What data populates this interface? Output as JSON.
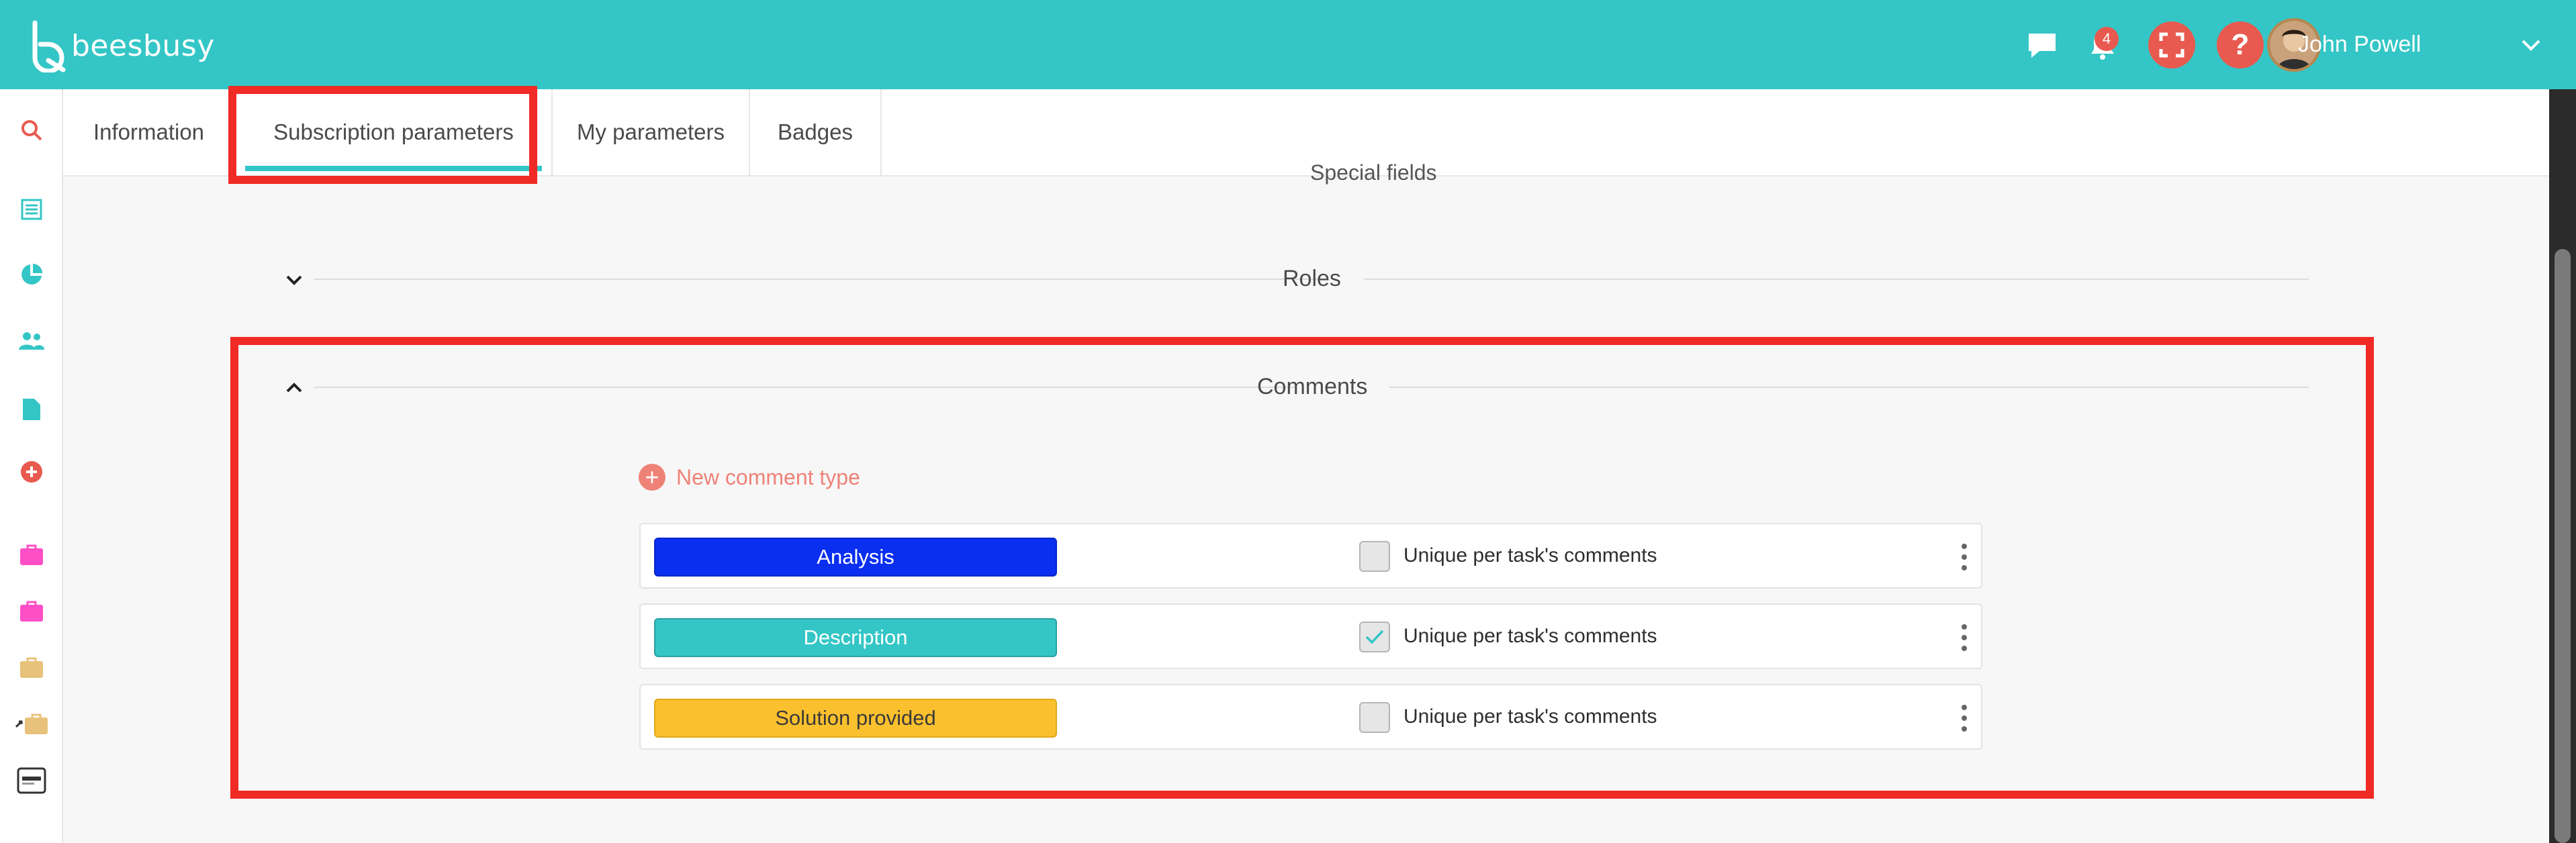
{
  "app": {
    "name": "beesbusy"
  },
  "header": {
    "notification_count": "4",
    "help_label": "?",
    "user_name": "John Powell"
  },
  "tabs": [
    {
      "label": "Information"
    },
    {
      "label": "Subscription parameters",
      "active": true
    },
    {
      "label": "My parameters"
    },
    {
      "label": "Badges"
    }
  ],
  "content": {
    "cut_off_heading": "Special fields",
    "sections": {
      "roles": {
        "title": "Roles",
        "expanded": false
      },
      "comments": {
        "title": "Comments",
        "expanded": true
      }
    },
    "new_comment_type_label": "New comment type",
    "comment_types": [
      {
        "name": "Analysis",
        "color": "#0a2ff0",
        "text_color": "#ffffff",
        "unique_checked": false,
        "unique_label": "Unique per task's comments"
      },
      {
        "name": "Description",
        "color": "#34c6c6",
        "text_color": "#ffffff",
        "unique_checked": true,
        "unique_label": "Unique per task's comments"
      },
      {
        "name": "Solution provided",
        "color": "#fbc02d",
        "text_color": "#3a3a3a",
        "unique_checked": false,
        "unique_label": "Unique per task's comments"
      }
    ]
  },
  "colors": {
    "brand": "#34c6c6",
    "accent_red": "#e85a4f",
    "highlight": "#f02a25"
  },
  "icons": {
    "rail": [
      "search-icon",
      "list-icon",
      "pie-chart-icon",
      "users-icon",
      "document-icon",
      "add-circle-icon",
      "briefcase-icon",
      "briefcase-icon",
      "briefcase-icon",
      "briefcase-icon",
      "logo-icon"
    ],
    "header": [
      "chat-icon",
      "bell-icon",
      "fullscreen-icon",
      "help-icon",
      "avatar",
      "chevron-down-icon"
    ]
  }
}
